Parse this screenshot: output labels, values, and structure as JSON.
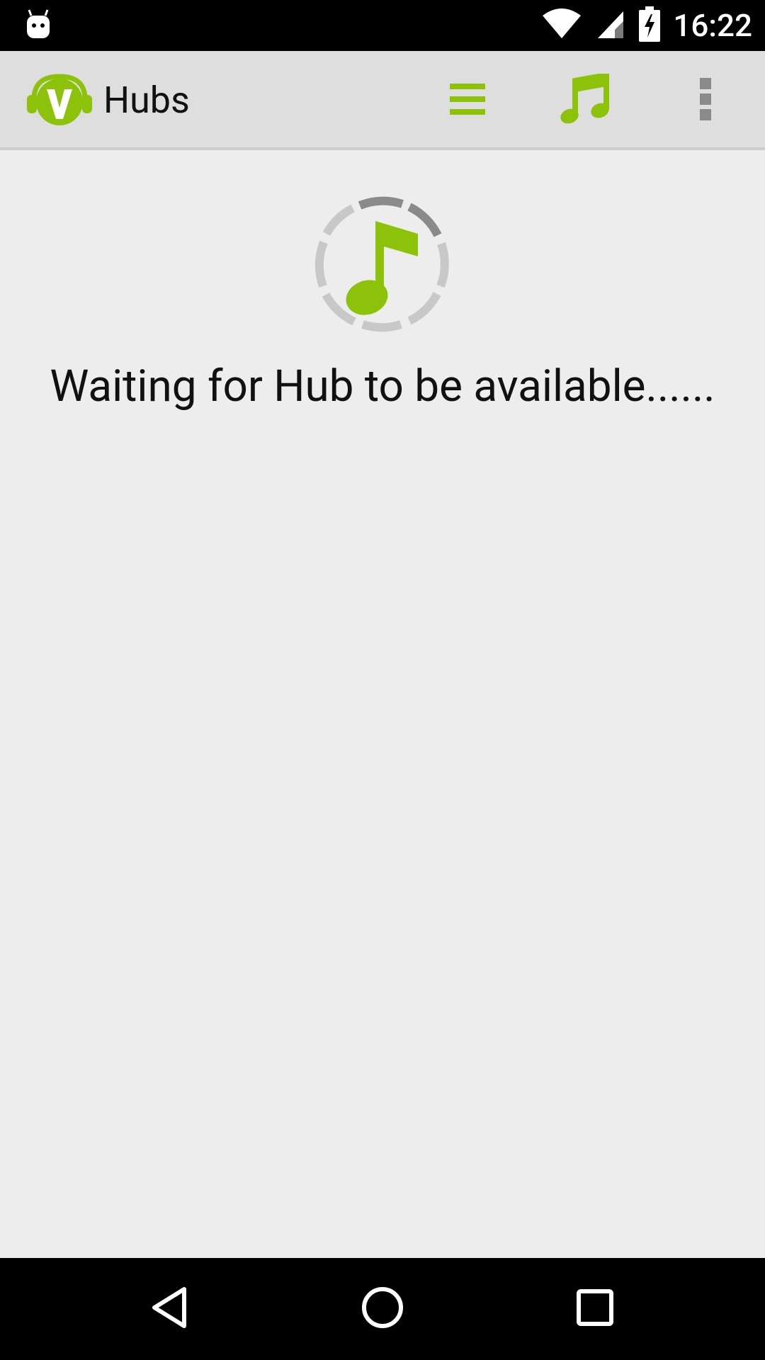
{
  "status_bar": {
    "time": "16:22",
    "icons": [
      "android-notification-icon",
      "wifi-icon",
      "cell-signal-icon",
      "battery-charging-icon"
    ]
  },
  "app_bar": {
    "title": "Hubs",
    "logo": "app-logo-icon",
    "actions": [
      {
        "name": "list-menu",
        "icon": "list-icon"
      },
      {
        "name": "music",
        "icon": "music-note-icon"
      },
      {
        "name": "overflow-menu",
        "icon": "more-vertical-icon"
      }
    ]
  },
  "content": {
    "status_message": "Waiting for Hub to be available......",
    "loader_icon": "music-note-spinner-icon"
  },
  "nav_bar": {
    "buttons": [
      "back-icon",
      "home-icon",
      "recents-icon"
    ]
  },
  "colors": {
    "accent": "#8cc20a",
    "app_bar_bg": "#dedede",
    "content_bg": "#ededed",
    "system_bar_bg": "#000000",
    "spinner_light": "#c8c8c8",
    "spinner_dark": "#8a8a8a"
  }
}
